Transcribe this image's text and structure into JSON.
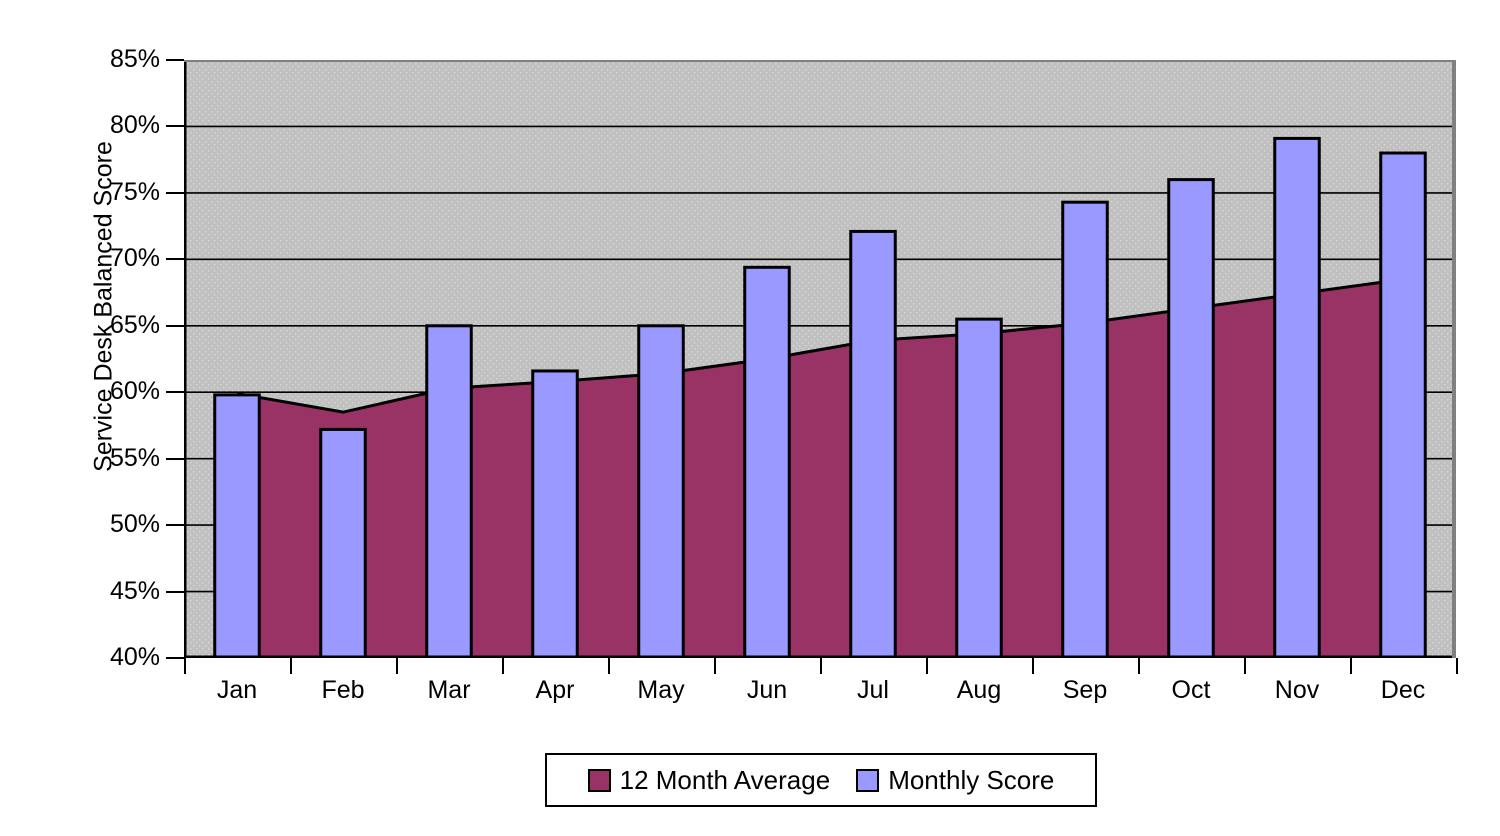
{
  "chart_data": {
    "type": "bar",
    "title": "",
    "xlabel": "",
    "ylabel": "Service Desk Balanced Score",
    "ylim": [
      40,
      85
    ],
    "ytick_step": 5,
    "ytick_labels": [
      "85%",
      "80%",
      "75%",
      "70%",
      "65%",
      "60%",
      "55%",
      "50%",
      "45%",
      "40%"
    ],
    "ytick_values": [
      85,
      80,
      75,
      70,
      65,
      60,
      55,
      50,
      45,
      40
    ],
    "grid": true,
    "legend_position": "bottom",
    "categories": [
      "Jan",
      "Feb",
      "Mar",
      "Apr",
      "May",
      "Jun",
      "Jul",
      "Aug",
      "Sep",
      "Oct",
      "Nov",
      "Dec"
    ],
    "series": [
      {
        "name": "12 Month Average",
        "type": "area",
        "color": "#993366",
        "values": [
          59.9,
          58.5,
          60.3,
          60.8,
          61.4,
          62.5,
          63.9,
          64.4,
          65.2,
          66.3,
          67.4,
          68.5
        ]
      },
      {
        "name": "Monthly Score",
        "type": "bar",
        "color": "#9999FF",
        "values": [
          59.8,
          57.2,
          65.0,
          61.6,
          65.0,
          69.4,
          72.1,
          65.5,
          74.3,
          76.0,
          79.1,
          78.0
        ]
      }
    ],
    "plot_background": "#C0C0C0",
    "axis_color": "#000000"
  },
  "legend": {
    "entries": [
      {
        "label": "12 Month Average",
        "color": "#993366"
      },
      {
        "label": "Monthly Score",
        "color": "#9999FF"
      }
    ]
  },
  "axes": {
    "y_title": "Service Desk Balanced Score"
  }
}
